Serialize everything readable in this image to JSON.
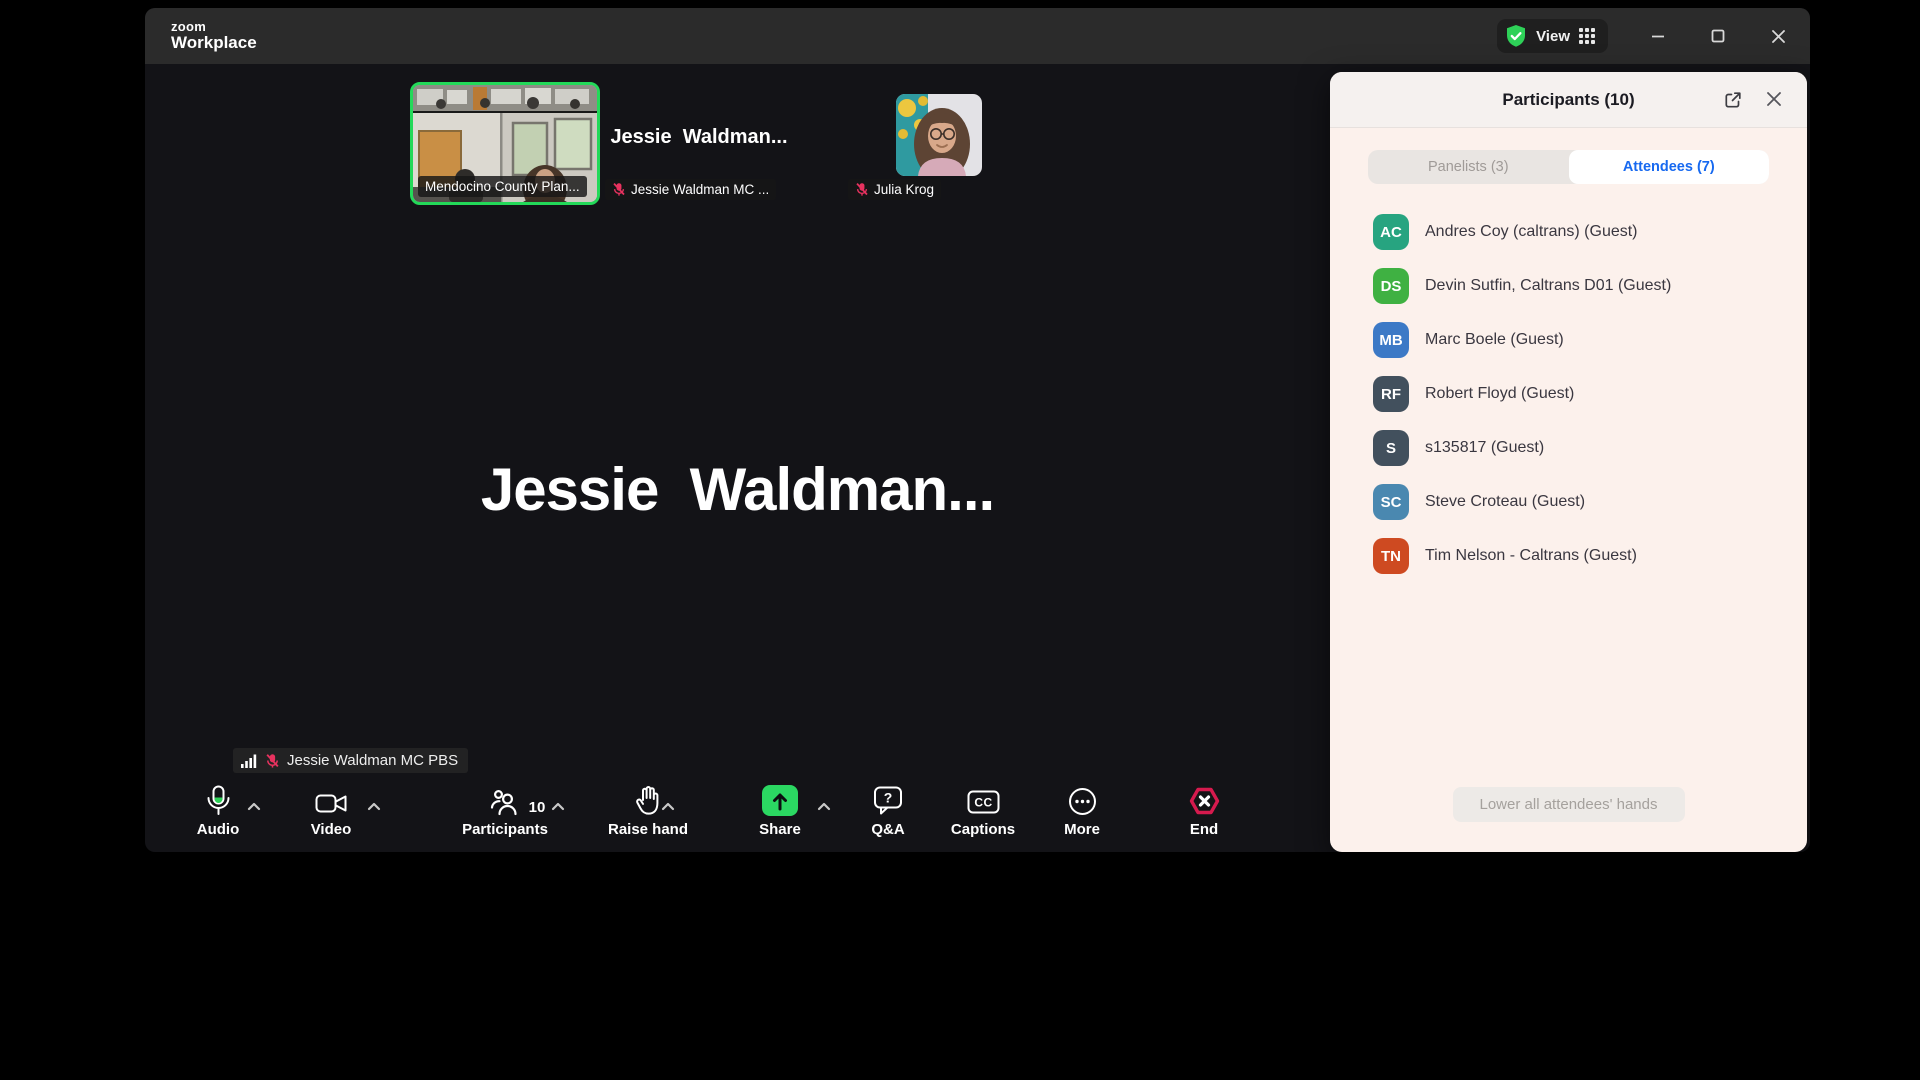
{
  "titlebar": {
    "logo_top": "zoom",
    "logo_bottom": "Workplace",
    "view_label": "View"
  },
  "video_strip": {
    "tiles": [
      {
        "label": "Mendocino County Plan...",
        "active_speaker": true,
        "muted": false
      },
      {
        "label": "Jessie Waldman MC ...",
        "center_text": "Jessie  Waldman...",
        "muted": true
      },
      {
        "label": "Julia Krog",
        "muted": true
      }
    ]
  },
  "stage": {
    "big_name": "Jessie  Waldman...",
    "speaker_pill": "Jessie Waldman MC PBS"
  },
  "toolbar": {
    "participants_count": "10",
    "buttons": [
      {
        "label": "Audio"
      },
      {
        "label": "Video"
      },
      {
        "label": "Participants"
      },
      {
        "label": "Raise hand"
      },
      {
        "label": "Share"
      },
      {
        "label": "Q&A"
      },
      {
        "label": "Captions"
      },
      {
        "label": "More"
      },
      {
        "label": "End"
      }
    ]
  },
  "participants_panel": {
    "title": "Participants (10)",
    "tabs": [
      {
        "label": "Panelists (3)",
        "active": false
      },
      {
        "label": "Attendees (7)",
        "active": true
      }
    ],
    "attendees": [
      {
        "initials": "AC",
        "name": "Andres Coy (caltrans) (Guest)",
        "color": "#27a480"
      },
      {
        "initials": "DS",
        "name": "Devin Sutfin, Caltrans D01 (Guest)",
        "color": "#3fb142"
      },
      {
        "initials": "MB",
        "name": "Marc Boele (Guest)",
        "color": "#3c79c6"
      },
      {
        "initials": "RF",
        "name": "Robert Floyd (Guest)",
        "color": "#42505d"
      },
      {
        "initials": "S",
        "name": "s135817 (Guest)",
        "color": "#42505d"
      },
      {
        "initials": "SC",
        "name": "Steve Croteau (Guest)",
        "color": "#4a88b0"
      },
      {
        "initials": "TN",
        "name": "Tim Nelson - Caltrans (Guest)",
        "color": "#ce4a21"
      }
    ],
    "footer_button": "Lower all attendees' hands"
  },
  "colors": {
    "accent_green": "#23d959",
    "share_green": "#2bd862",
    "end_red": "#d61a4e",
    "active_tab_blue": "#1769f0",
    "muted_mic_red": "#e8325f",
    "panel_bg": "#fcf1ec",
    "titlebar_bg": "#2b2b2b"
  }
}
